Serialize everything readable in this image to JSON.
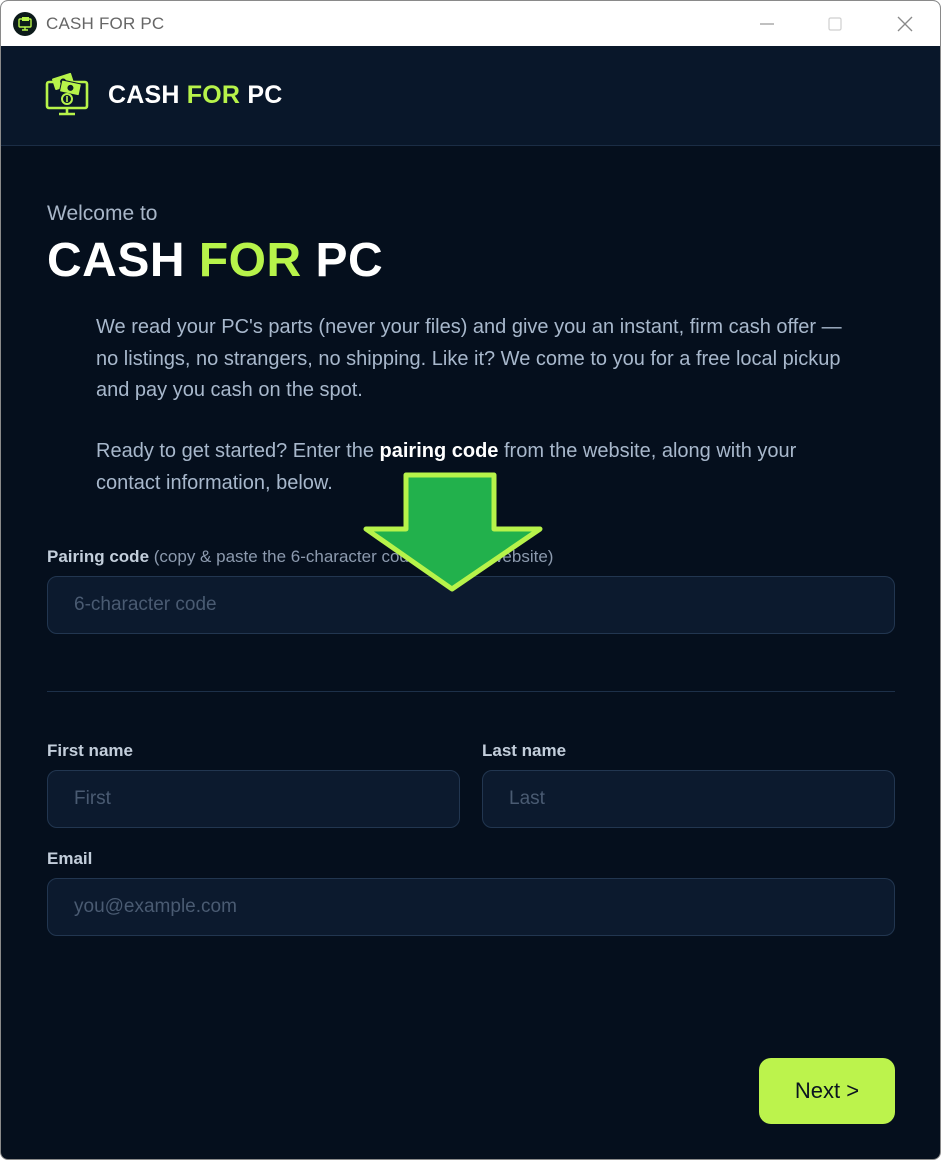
{
  "window": {
    "title": "CASH FOR PC"
  },
  "header": {
    "brand_part1": "CASH",
    "brand_part2": "FOR",
    "brand_part3": "PC"
  },
  "welcome": {
    "subtitle": "Welcome to",
    "title_part1": "CASH",
    "title_part2": "FOR",
    "title_part3": "PC"
  },
  "intro": {
    "paragraph1": "We read your PC's parts (never your files) and give you an instant, firm cash offer — no listings, no strangers, no shipping. Like it? We come to you for a free local pickup and pay you cash on the spot.",
    "paragraph2_before": "Ready to get started? Enter the ",
    "paragraph2_bold": "pairing code",
    "paragraph2_after": " from the website, along with your contact information, below."
  },
  "form": {
    "pairing_label": "Pairing code",
    "pairing_hint": " (copy & paste the 6-character code from the website)",
    "pairing_placeholder": "6-character code",
    "first_name_label": "First name",
    "first_name_placeholder": "First",
    "last_name_label": "Last name",
    "last_name_placeholder": "Last",
    "email_label": "Email",
    "email_placeholder": "you@example.com"
  },
  "actions": {
    "next_label": "Next >"
  },
  "colors": {
    "accent": "#b7f34a",
    "background": "#050f1d",
    "header_bg": "#09172a",
    "arrow": "#22b14c"
  },
  "icons": {
    "app_icon": "cash-monitor-icon",
    "minimize": "minimize-icon",
    "maximize": "maximize-icon",
    "close": "close-icon",
    "overlay": "arrow-down-icon"
  }
}
